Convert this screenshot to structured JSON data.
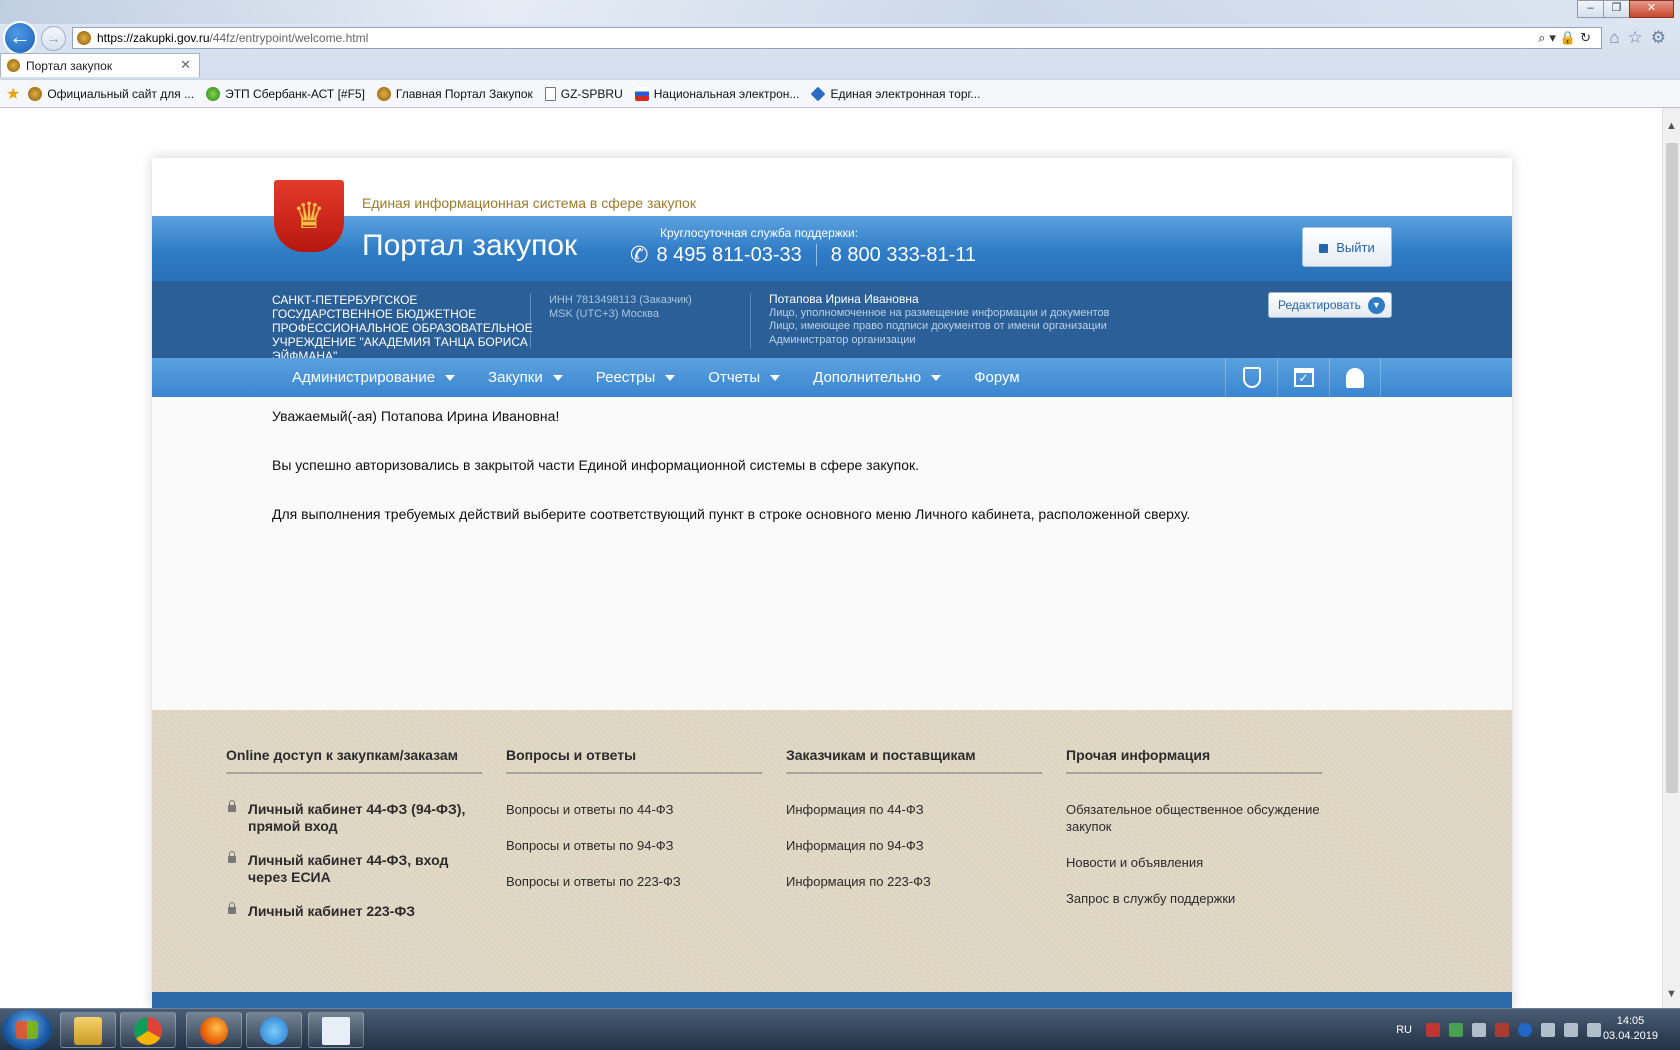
{
  "browser": {
    "url_main": "https://zakupki.gov.ru",
    "url_rest": "/44fz/entrypoint/welcome.html",
    "tab_title": "Портал закупок",
    "tab_close": "✕",
    "window_controls": [
      "–",
      "❐",
      "✕"
    ],
    "favorites": [
      {
        "label": "Официальный сайт для ...",
        "icon": "gerb-icon"
      },
      {
        "label": "ЭТП Сбербанк-АСТ [#F5]",
        "icon": "sber-icon"
      },
      {
        "label": "Главная Портал Закупок",
        "icon": "gerb-icon"
      },
      {
        "label": "GZ-SPBRU",
        "icon": "document-icon"
      },
      {
        "label": "Национальная электрон...",
        "icon": "flag-icon"
      },
      {
        "label": "Единая электронная торг...",
        "icon": "diamond-icon"
      }
    ]
  },
  "header": {
    "subtitle": "Единая информационная система в сфере закупок",
    "title": "Портал закупок",
    "support_caption": "Круглосуточная служба поддержки:",
    "phone1": "8 495 811-03-33",
    "phone2": "8 800 333-81-11",
    "logout_label": "Выйти"
  },
  "org": {
    "name": "САНКТ-ПЕТЕРБУРГСКОЕ ГОСУДАРСТВЕННОЕ БЮДЖЕТНОЕ ПРОФЕССИОНАЛЬНОЕ ОБРАЗОВАТЕЛЬНОЕ УЧРЕЖДЕНИЕ \"АКАДЕМИЯ ТАНЦА БОРИСА ЭЙФМАНА\"",
    "inn": "ИНН 7813498113 (Заказчик)",
    "timezone": "MSK (UTC+3) Москва"
  },
  "user": {
    "name": "Потапова Ирина Ивановна",
    "roles": [
      "Лицо, уполномоченное на размещение информации и документов",
      "Лицо, имеющее право подписи документов от имени организации",
      "Администратор организации"
    ],
    "edit_label": "Редактировать"
  },
  "nav": {
    "items": [
      {
        "label": "Администрирование",
        "dropdown": true
      },
      {
        "label": "Закупки",
        "dropdown": true
      },
      {
        "label": "Реестры",
        "dropdown": true
      },
      {
        "label": "Отчеты",
        "dropdown": true
      },
      {
        "label": "Дополнительно",
        "dropdown": true
      },
      {
        "label": "Форум",
        "dropdown": false
      }
    ],
    "icons": [
      "shield-icon",
      "calendar-check-icon",
      "bell-icon"
    ]
  },
  "content": {
    "greeting": "Уважаемый(-ая) Потапова Ирина Ивановна!",
    "line1": "Вы успешно авторизовались в закрытой части Единой информационной системы в сфере закупок.",
    "line2": "Для выполнения требуемых действий выберите соответствующий пункт в строке основного меню Личного кабинета, расположенной сверху."
  },
  "footer": {
    "columns": [
      {
        "title": "Online доступ к закупкам/заказам",
        "links": [
          "Личный кабинет 44-ФЗ (94-ФЗ), прямой вход",
          "Личный кабинет 44-ФЗ, вход через ЕСИА",
          "Личный кабинет 223-ФЗ"
        ]
      },
      {
        "title": "Вопросы и ответы",
        "links": [
          "Вопросы и ответы по 44-ФЗ",
          "Вопросы и ответы по 94-ФЗ",
          "Вопросы и ответы по 223-ФЗ"
        ]
      },
      {
        "title": "Заказчикам и поставщикам",
        "links": [
          "Информация по 44-ФЗ",
          "Информация по 94-ФЗ",
          "Информация по 223-ФЗ"
        ]
      },
      {
        "title": "Прочая информация",
        "links": [
          "Обязательное общественное обсуждение закупок",
          "Новости и объявления",
          "Запрос в службу поддержки"
        ]
      }
    ]
  },
  "taskbar": {
    "language": "RU",
    "time": "14:05",
    "date": "03.04.2019"
  },
  "colors": {
    "brand_blue": "#2f7cc5",
    "dark_blue": "#2a5f97",
    "gold": "#9c7a2b"
  }
}
